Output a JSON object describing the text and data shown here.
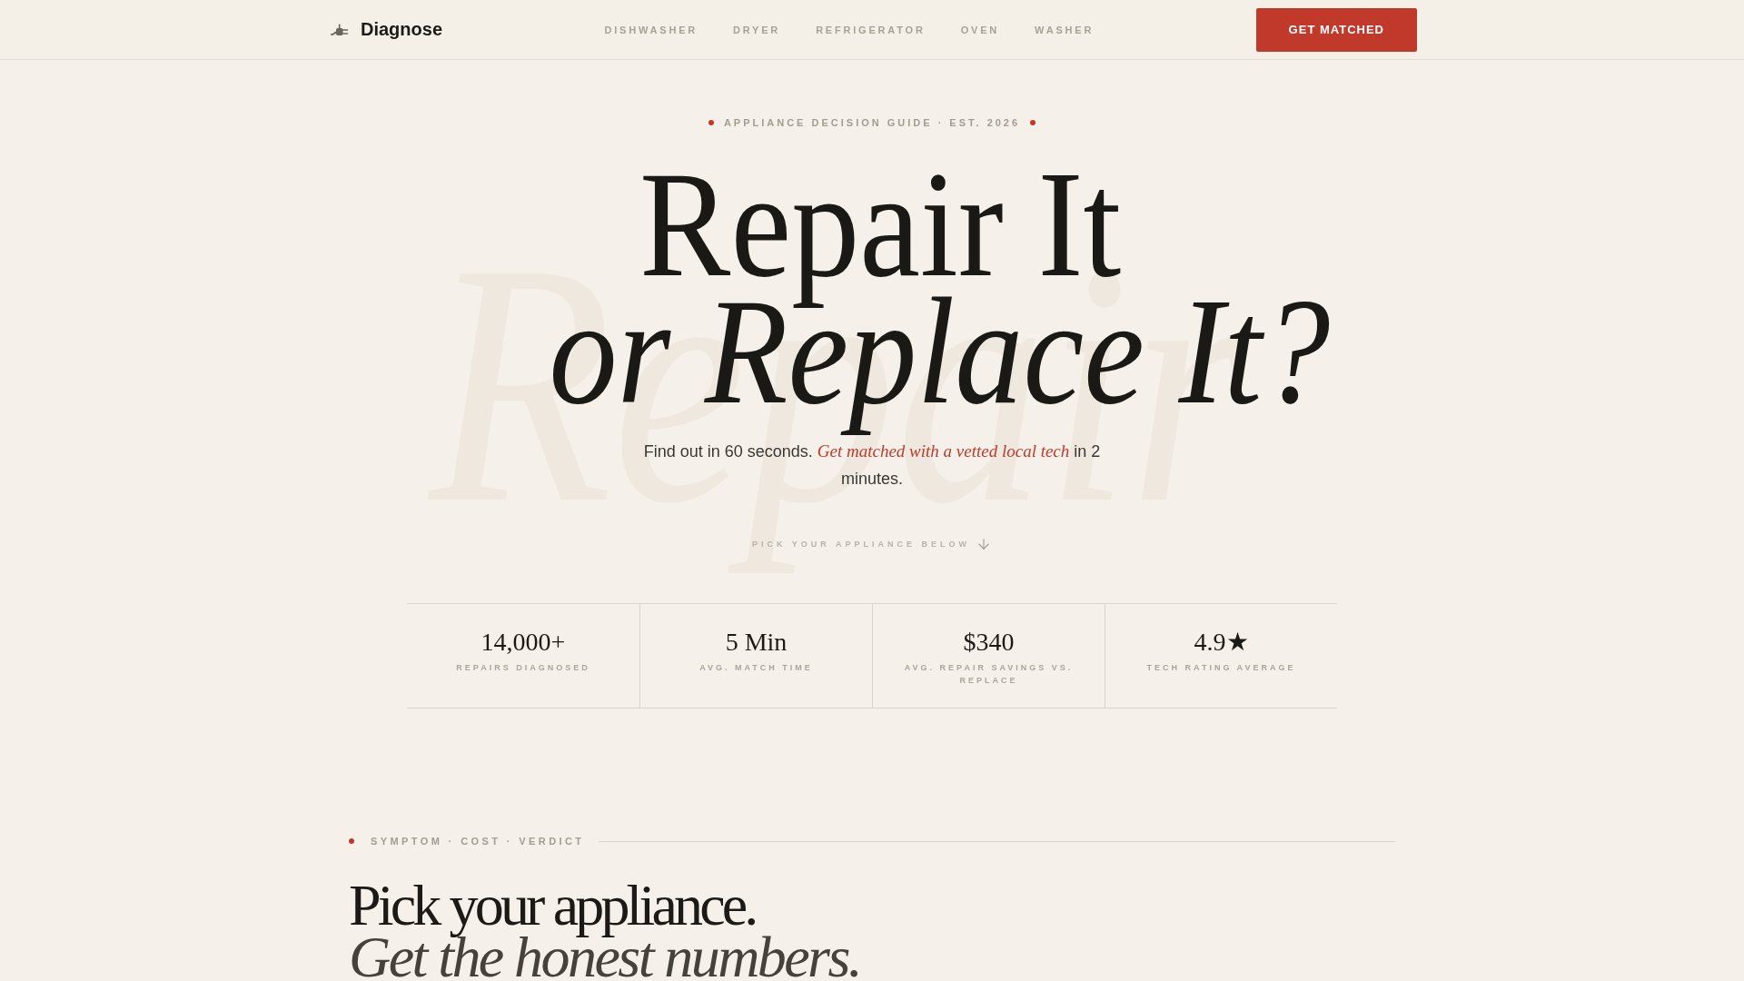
{
  "header": {
    "logo": "Diagnose",
    "nav": [
      "DISHWASHER",
      "DRYER",
      "REFRIGERATOR",
      "OVEN",
      "WASHER"
    ],
    "cta": "GET MATCHED"
  },
  "hero": {
    "eyebrow": "APPLIANCE DECISION GUIDE · EST. 2026",
    "backdrop_word": "Repair",
    "title_line_1": "Repair It",
    "title_line_2": "or Replace It?",
    "subtitle": "Find out in 60 seconds. *Get matched with a vetted local tech* in 2 minutes.",
    "scroll_hint": "PICK YOUR APPLIANCE BELOW"
  },
  "stats": [
    {
      "value": "14,000+",
      "label": "REPAIRS DIAGNOSED"
    },
    {
      "value": "5 Min",
      "label": "AVG. MATCH TIME"
    },
    {
      "value": "$340",
      "label": "AVG. REPAIR SAVINGS VS. REPLACE"
    },
    {
      "value": "4.9★",
      "label": "TECH RATING AVERAGE"
    }
  ],
  "section": {
    "eyebrow": "SYMPTOM · COST · VERDICT",
    "title_line_1": "Pick your appliance.",
    "title_line_2": "Get the honest numbers."
  }
}
